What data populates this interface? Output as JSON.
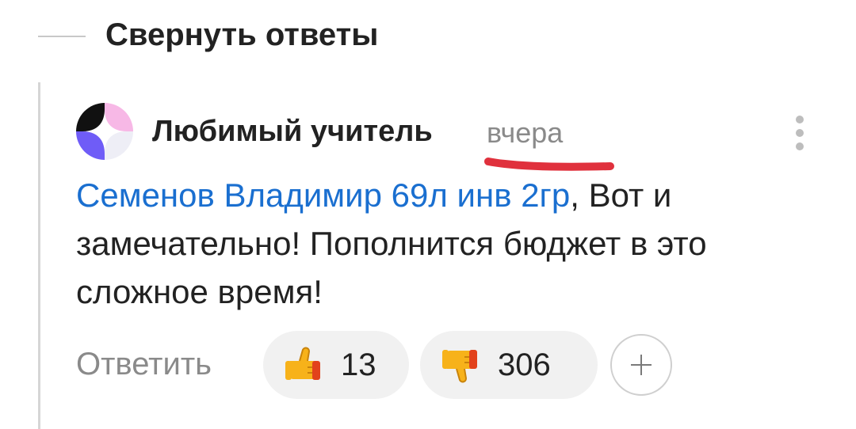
{
  "collapse": {
    "label": "Свернуть ответы"
  },
  "comment": {
    "author": "Любимый учитель",
    "timestamp": "вчера",
    "mention": "Семенов Владимир 69л инв 2гр",
    "text": ", Вот и замечательно! Пополнится бюджет в это сложное время!",
    "more_icon": "more-vertical-icon",
    "avatar_colors": [
      "#111111",
      "#f7b8e6",
      "#6f5cf7",
      "#eeeef6"
    ]
  },
  "actions": {
    "reply_label": "Ответить",
    "like": {
      "icon": "thumbs-up-emoji",
      "count": "13"
    },
    "dislike": {
      "icon": "thumbs-down-emoji",
      "count": "306"
    },
    "add_reaction_icon": "plus-icon"
  },
  "annotation": {
    "underline_color": "#e0313d"
  },
  "colors": {
    "link": "#1a6fd0",
    "muted": "#8a8a8a",
    "text": "#222222",
    "pill_bg": "#f1f1f1"
  }
}
